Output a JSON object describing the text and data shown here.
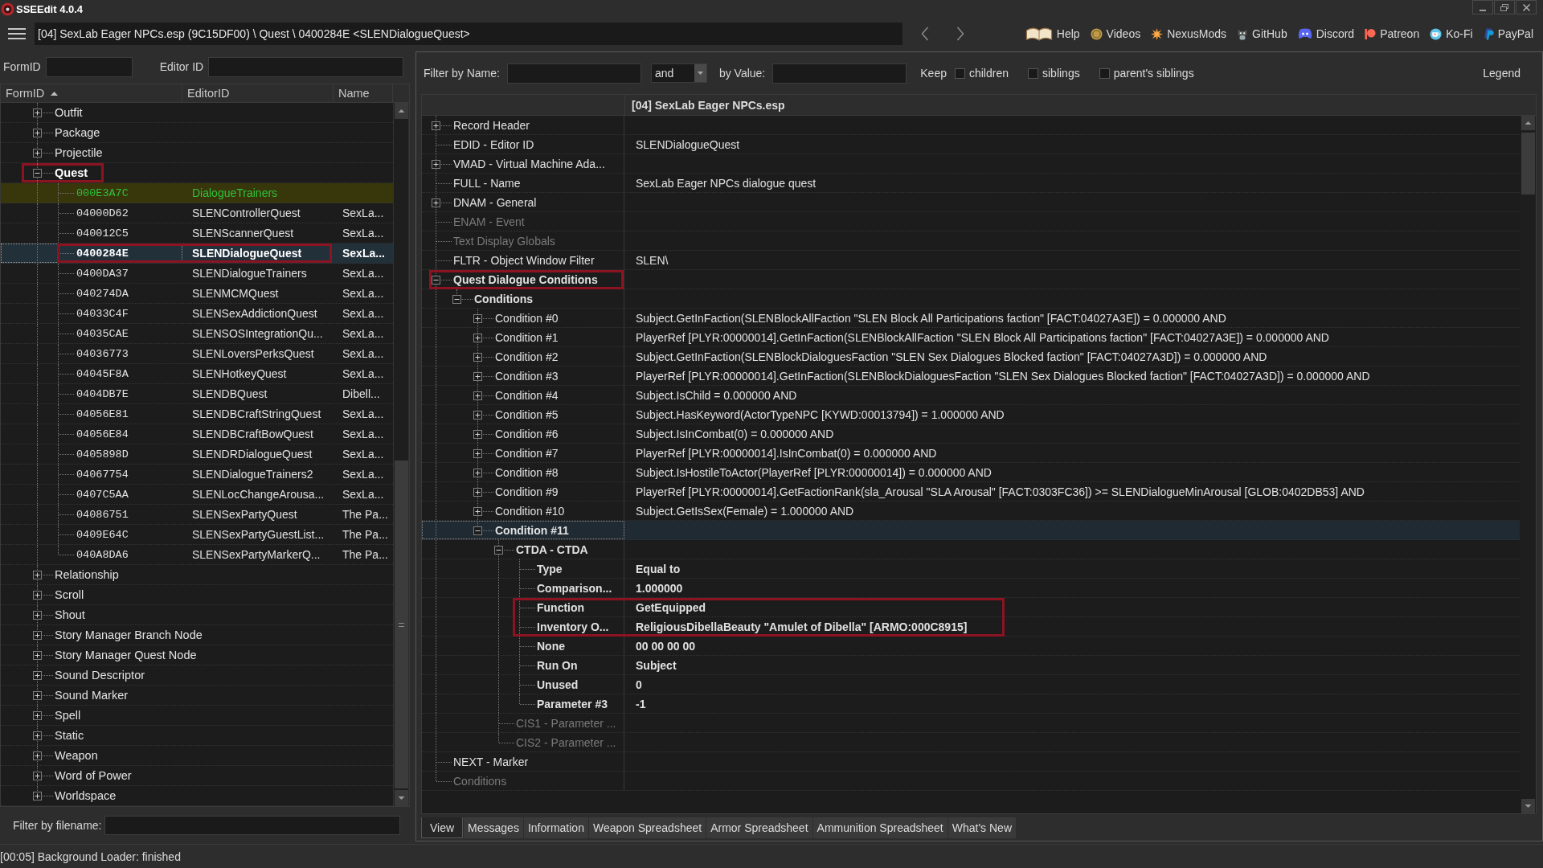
{
  "window": {
    "title": "SSEEdit 4.0.4"
  },
  "toolbar": {
    "path": "[04] SexLab Eager NPCs.esp (9C15DF00) \\ Quest \\ 0400284E <SLENDialogueQuest>",
    "links": [
      "Help",
      "Videos",
      "NexusMods",
      "GitHub",
      "Discord",
      "Patreon",
      "Ko-Fi",
      "PayPal"
    ]
  },
  "navigator": {
    "form_id_filter": {
      "label": "FormID"
    },
    "editor_id_filter": {
      "label": "Editor ID"
    },
    "columns": [
      {
        "label": "FormID",
        "sorted": true
      },
      {
        "label": "EditorID",
        "sorted": false
      },
      {
        "label": "Name",
        "sorted": false
      }
    ],
    "groups": [
      {
        "label": "Outfit",
        "expanded": false,
        "selected": false,
        "emphasized": false,
        "highlighted": false
      },
      {
        "label": "Package",
        "expanded": false,
        "selected": false,
        "emphasized": false,
        "highlighted": false
      },
      {
        "label": "Projectile",
        "expanded": false,
        "selected": false,
        "emphasized": false,
        "highlighted": false
      },
      {
        "label": "Quest",
        "expanded": true,
        "selected": false,
        "emphasized": true,
        "highlighted": true,
        "children": [
          {
            "form_id": "000E3A7C",
            "editor_id": "DialogueTrainers",
            "injected": true,
            "selected": false,
            "highlighted": false
          },
          {
            "form_id": "04000D62",
            "editor_id": "SLENControllerQuest",
            "name": "SexLa...",
            "injected": false,
            "selected": false,
            "highlighted": false
          },
          {
            "form_id": "040012C5",
            "editor_id": "SLENScannerQuest",
            "name": "SexLa...",
            "injected": false,
            "selected": false,
            "highlighted": false
          },
          {
            "form_id": "0400284E",
            "editor_id": "SLENDialogueQuest",
            "name": "SexLa...",
            "injected": false,
            "selected": true,
            "highlighted": true
          },
          {
            "form_id": "0400DA37",
            "editor_id": "SLENDialogueTrainers",
            "name": "SexLa...",
            "injected": false,
            "selected": false,
            "highlighted": false
          },
          {
            "form_id": "040274DA",
            "editor_id": "SLENMCMQuest",
            "name": "SexLa...",
            "injected": false,
            "selected": false,
            "highlighted": false
          },
          {
            "form_id": "04033C4F",
            "editor_id": "SLENSexAddictionQuest",
            "name": "SexLa...",
            "injected": false,
            "selected": false,
            "highlighted": false
          },
          {
            "form_id": "04035CAE",
            "editor_id": "SLENSOSIntegrationQu...",
            "name": "SexLa...",
            "injected": false,
            "selected": false,
            "highlighted": false
          },
          {
            "form_id": "04036773",
            "editor_id": "SLENLoversPerksQuest",
            "name": "SexLa...",
            "injected": false,
            "selected": false,
            "highlighted": false
          },
          {
            "form_id": "04045F8A",
            "editor_id": "SLENHotkeyQuest",
            "name": "SexLa...",
            "injected": false,
            "selected": false,
            "highlighted": false
          },
          {
            "form_id": "0404DB7E",
            "editor_id": "SLENDBQuest",
            "name": "Dibell...",
            "injected": false,
            "selected": false,
            "highlighted": false
          },
          {
            "form_id": "04056E81",
            "editor_id": "SLENDBCraftStringQuest",
            "name": "SexLa...",
            "injected": false,
            "selected": false,
            "highlighted": false
          },
          {
            "form_id": "04056E84",
            "editor_id": "SLENDBCraftBowQuest",
            "name": "SexLa...",
            "injected": false,
            "selected": false,
            "highlighted": false
          },
          {
            "form_id": "0405898D",
            "editor_id": "SLENDRDialogueQuest",
            "name": "SexLa...",
            "injected": false,
            "selected": false,
            "highlighted": false
          },
          {
            "form_id": "04067754",
            "editor_id": "SLENDialogueTrainers2",
            "name": "SexLa...",
            "injected": false,
            "selected": false,
            "highlighted": false
          },
          {
            "form_id": "0407C5AA",
            "editor_id": "SLENLocChangeArousa...",
            "name": "SexLa...",
            "injected": false,
            "selected": false,
            "highlighted": false
          },
          {
            "form_id": "04086751",
            "editor_id": "SLENSexPartyQuest",
            "name": "The Pa...",
            "injected": false,
            "selected": false,
            "highlighted": false
          },
          {
            "form_id": "0409E64C",
            "editor_id": "SLENSexPartyGuestList...",
            "name": "The Pa...",
            "injected": false,
            "selected": false,
            "highlighted": false
          },
          {
            "form_id": "040A8DA6",
            "editor_id": "SLENSexPartyMarkerQ...",
            "name": "The Pa...",
            "injected": false,
            "selected": false,
            "highlighted": false
          }
        ]
      },
      {
        "label": "Relationship",
        "expanded": false,
        "selected": false,
        "emphasized": false,
        "highlighted": false
      },
      {
        "label": "Scroll",
        "expanded": false,
        "selected": false,
        "emphasized": false,
        "highlighted": false
      },
      {
        "label": "Shout",
        "expanded": false,
        "selected": false,
        "emphasized": false,
        "highlighted": false
      },
      {
        "label": "Story Manager Branch Node",
        "expanded": false,
        "selected": false,
        "emphasized": false,
        "highlighted": false
      },
      {
        "label": "Story Manager Quest Node",
        "expanded": false,
        "selected": false,
        "emphasized": false,
        "highlighted": false
      },
      {
        "label": "Sound Descriptor",
        "expanded": false,
        "selected": false,
        "emphasized": false,
        "highlighted": false
      },
      {
        "label": "Sound Marker",
        "expanded": false,
        "selected": false,
        "emphasized": false,
        "highlighted": false
      },
      {
        "label": "Spell",
        "expanded": false,
        "selected": false,
        "emphasized": false,
        "highlighted": false
      },
      {
        "label": "Static",
        "expanded": false,
        "selected": false,
        "emphasized": false,
        "highlighted": false
      },
      {
        "label": "Weapon",
        "expanded": false,
        "selected": false,
        "emphasized": false,
        "highlighted": false
      },
      {
        "label": "Word of Power",
        "expanded": false,
        "selected": false,
        "emphasized": false,
        "highlighted": false
      },
      {
        "label": "Worldspace",
        "expanded": false,
        "selected": false,
        "emphasized": false,
        "highlighted": false
      }
    ],
    "filename_filter": {
      "label": "Filter by filename:"
    }
  },
  "record_filter": {
    "name_label": "Filter by Name:",
    "operator": "and",
    "value_label": "by Value:",
    "keep_label": "Keep",
    "options": [
      {
        "label": "children",
        "checked": false
      },
      {
        "label": "siblings",
        "checked": false
      },
      {
        "label": "parent's siblings",
        "checked": false
      }
    ],
    "legend": "Legend"
  },
  "record_view": {
    "header": "[04] SexLab Eager NPCs.esp",
    "rows": [
      {
        "label": "Record Header",
        "expanded": false,
        "selected": false,
        "disabled": false,
        "emphasized": false,
        "highlighted": false
      },
      {
        "label": "EDID - Editor ID",
        "value": "SLENDialogueQuest",
        "selected": false,
        "disabled": false,
        "emphasized": false,
        "highlighted": false
      },
      {
        "label": "VMAD - Virtual Machine Ada...",
        "expanded": false,
        "selected": false,
        "disabled": false,
        "emphasized": false,
        "highlighted": false
      },
      {
        "label": "FULL - Name",
        "value": "SexLab Eager NPCs dialogue quest",
        "selected": false,
        "disabled": false,
        "emphasized": false,
        "highlighted": false
      },
      {
        "label": "DNAM - General",
        "expanded": false,
        "selected": false,
        "disabled": false,
        "emphasized": false,
        "highlighted": false
      },
      {
        "label": "ENAM - Event",
        "selected": false,
        "disabled": true,
        "emphasized": false,
        "highlighted": false
      },
      {
        "label": "Text Display Globals",
        "selected": false,
        "disabled": true,
        "emphasized": false,
        "highlighted": false
      },
      {
        "label": "FLTR - Object Window Filter",
        "value": "SLEN\\",
        "selected": false,
        "disabled": false,
        "emphasized": false,
        "highlighted": false
      },
      {
        "label": "Quest Dialogue Conditions",
        "expanded": true,
        "selected": false,
        "disabled": false,
        "emphasized": true,
        "highlighted": true,
        "children": [
          {
            "label": "Conditions",
            "expanded": true,
            "selected": false,
            "disabled": false,
            "emphasized": true,
            "highlighted": false,
            "children": [
              {
                "label": "Condition #0",
                "value": "Subject.GetInFaction(SLENBlockAllFaction \"SLEN Block All Participations faction\" [FACT:04027A3E]) = 0.000000 AND",
                "expanded": false,
                "selected": false,
                "disabled": false,
                "emphasized": false,
                "highlighted": false
              },
              {
                "label": "Condition #1",
                "value": "PlayerRef [PLYR:00000014].GetInFaction(SLENBlockAllFaction \"SLEN Block All Participations faction\" [FACT:04027A3E]) = 0.000000 AND",
                "expanded": false,
                "selected": false,
                "disabled": false,
                "emphasized": false,
                "highlighted": false
              },
              {
                "label": "Condition #2",
                "value": "Subject.GetInFaction(SLENBlockDialoguesFaction \"SLEN Sex Dialogues Blocked faction\" [FACT:04027A3D]) = 0.000000 AND",
                "expanded": false,
                "selected": false,
                "disabled": false,
                "emphasized": false,
                "highlighted": false
              },
              {
                "label": "Condition #3",
                "value": "PlayerRef [PLYR:00000014].GetInFaction(SLENBlockDialoguesFaction \"SLEN Sex Dialogues Blocked faction\" [FACT:04027A3D]) = 0.000000 AND",
                "expanded": false,
                "selected": false,
                "disabled": false,
                "emphasized": false,
                "highlighted": false
              },
              {
                "label": "Condition #4",
                "value": "Subject.IsChild = 0.000000 AND",
                "expanded": false,
                "selected": false,
                "disabled": false,
                "emphasized": false,
                "highlighted": false
              },
              {
                "label": "Condition #5",
                "value": "Subject.HasKeyword(ActorTypeNPC [KYWD:00013794]) = 1.000000 AND",
                "expanded": false,
                "selected": false,
                "disabled": false,
                "emphasized": false,
                "highlighted": false
              },
              {
                "label": "Condition #6",
                "value": "Subject.IsInCombat(0) = 0.000000 AND",
                "expanded": false,
                "selected": false,
                "disabled": false,
                "emphasized": false,
                "highlighted": false
              },
              {
                "label": "Condition #7",
                "value": "PlayerRef [PLYR:00000014].IsInCombat(0) = 0.000000 AND",
                "expanded": false,
                "selected": false,
                "disabled": false,
                "emphasized": false,
                "highlighted": false
              },
              {
                "label": "Condition #8",
                "value": "Subject.IsHostileToActor(PlayerRef [PLYR:00000014]) = 0.000000 AND",
                "expanded": false,
                "selected": false,
                "disabled": false,
                "emphasized": false,
                "highlighted": false
              },
              {
                "label": "Condition #9",
                "value": "PlayerRef [PLYR:00000014].GetFactionRank(sla_Arousal \"SLA Arousal\" [FACT:0303FC36]) >= SLENDialogueMinArousal [GLOB:0402DB53] AND",
                "expanded": false,
                "selected": false,
                "disabled": false,
                "emphasized": false,
                "highlighted": false
              },
              {
                "label": "Condition #10",
                "value": "Subject.GetIsSex(Female) = 1.000000 AND",
                "expanded": false,
                "selected": false,
                "disabled": false,
                "emphasized": false,
                "highlighted": false
              },
              {
                "label": "Condition #11",
                "expanded": true,
                "selected": true,
                "disabled": false,
                "emphasized": true,
                "highlighted": false,
                "children": [
                  {
                    "label": "CTDA - CTDA",
                    "expanded": true,
                    "selected": false,
                    "disabled": false,
                    "emphasized": true,
                    "highlighted": false,
                    "children": [
                      {
                        "label": "Type",
                        "value": "Equal to",
                        "selected": false,
                        "disabled": false,
                        "emphasized": true,
                        "highlighted": false
                      },
                      {
                        "label": "Comparison...",
                        "value": "1.000000",
                        "selected": false,
                        "disabled": false,
                        "emphasized": true,
                        "highlighted": false
                      },
                      {
                        "label": "Function",
                        "value": "GetEquipped",
                        "selected": false,
                        "disabled": false,
                        "emphasized": true,
                        "highlighted": true
                      },
                      {
                        "label": "Inventory O...",
                        "value": "ReligiousDibellaBeauty \"Amulet of Dibella\" [ARMO:000C8915]",
                        "selected": false,
                        "disabled": false,
                        "emphasized": true,
                        "highlighted": true
                      },
                      {
                        "label": "None",
                        "value": "00 00 00 00",
                        "selected": false,
                        "disabled": false,
                        "emphasized": true,
                        "highlighted": false
                      },
                      {
                        "label": "Run On",
                        "value": "Subject",
                        "selected": false,
                        "disabled": false,
                        "emphasized": true,
                        "highlighted": false
                      },
                      {
                        "label": "Unused",
                        "value": "0",
                        "selected": false,
                        "disabled": false,
                        "emphasized": true,
                        "highlighted": false
                      },
                      {
                        "label": "Parameter #3",
                        "value": "-1",
                        "selected": false,
                        "disabled": false,
                        "emphasized": true,
                        "highlighted": false
                      }
                    ]
                  },
                  {
                    "label": "CIS1 - Parameter ...",
                    "selected": false,
                    "disabled": true,
                    "emphasized": false,
                    "highlighted": false
                  },
                  {
                    "label": "CIS2 - Parameter ...",
                    "selected": false,
                    "disabled": true,
                    "emphasized": false,
                    "highlighted": false
                  }
                ]
              }
            ]
          }
        ]
      },
      {
        "label": "NEXT - Marker",
        "selected": false,
        "disabled": false,
        "emphasized": false,
        "highlighted": false
      },
      {
        "label": "Conditions",
        "selected": false,
        "disabled": true,
        "emphasized": false,
        "highlighted": false
      }
    ]
  },
  "tabs": [
    {
      "label": "View",
      "selected": true
    },
    {
      "label": "Messages",
      "selected": false
    },
    {
      "label": "Information",
      "selected": false
    },
    {
      "label": "Weapon Spreadsheet",
      "selected": false
    },
    {
      "label": "Armor Spreadsheet",
      "selected": false
    },
    {
      "label": "Ammunition Spreadsheet",
      "selected": false
    },
    {
      "label": "What's New",
      "selected": false
    }
  ],
  "status_bar": {
    "text": "[00:05] Background Loader: finished"
  }
}
